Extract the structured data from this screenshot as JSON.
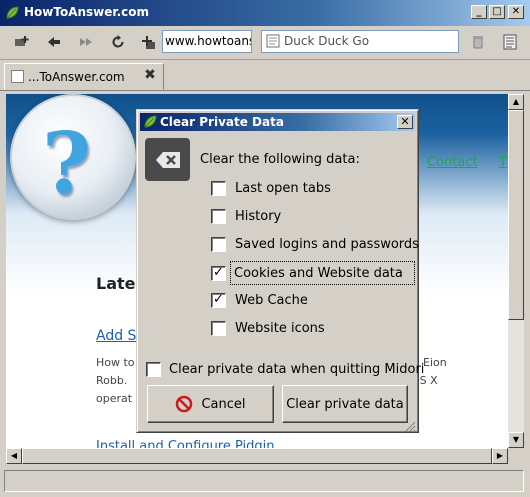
{
  "window": {
    "title": "HowToAnswer.com",
    "minimize_glyph": "_",
    "maximize_glyph": "□",
    "close_glyph": "✕"
  },
  "toolbar": {
    "url_value": "www.howtoanswer",
    "search_placeholder": "Duck Duck Go"
  },
  "tabs": [
    {
      "label": "...ToAnswer.com",
      "close_glyph": "✖"
    }
  ],
  "page": {
    "nav_links": [
      "Contact",
      "T"
    ],
    "heading": "Lates",
    "link": "Add Sh",
    "text_lines": [
      "How to",
      "Robb.",
      "operat"
    ],
    "text_right": [
      "by Eion",
      "OS X"
    ],
    "link2": "Install and Configure Pidgin"
  },
  "dialog": {
    "title": "Clear Private Data",
    "close_glyph": "✕",
    "heading": "Clear the following data:",
    "options": [
      {
        "label": "Last open tabs",
        "checked": false,
        "focused": false
      },
      {
        "label": "History",
        "checked": false,
        "focused": false
      },
      {
        "label": "Saved logins and passwords",
        "checked": false,
        "focused": false
      },
      {
        "label": "Cookies and Website data",
        "checked": true,
        "focused": true
      },
      {
        "label": "Web Cache",
        "checked": true,
        "focused": false
      },
      {
        "label": "Website icons",
        "checked": false,
        "focused": false
      }
    ],
    "quit_option": {
      "label": "Clear private data when quitting Midori",
      "checked": false
    },
    "cancel_label": "Cancel",
    "clear_label": "Clear private data"
  },
  "check_glyph": "✓",
  "colors": {
    "titlebar_start": "#0a246a",
    "link_green": "#1aa84f",
    "link_blue": "#1a5fb4",
    "chrome": "#d4d0c8"
  }
}
